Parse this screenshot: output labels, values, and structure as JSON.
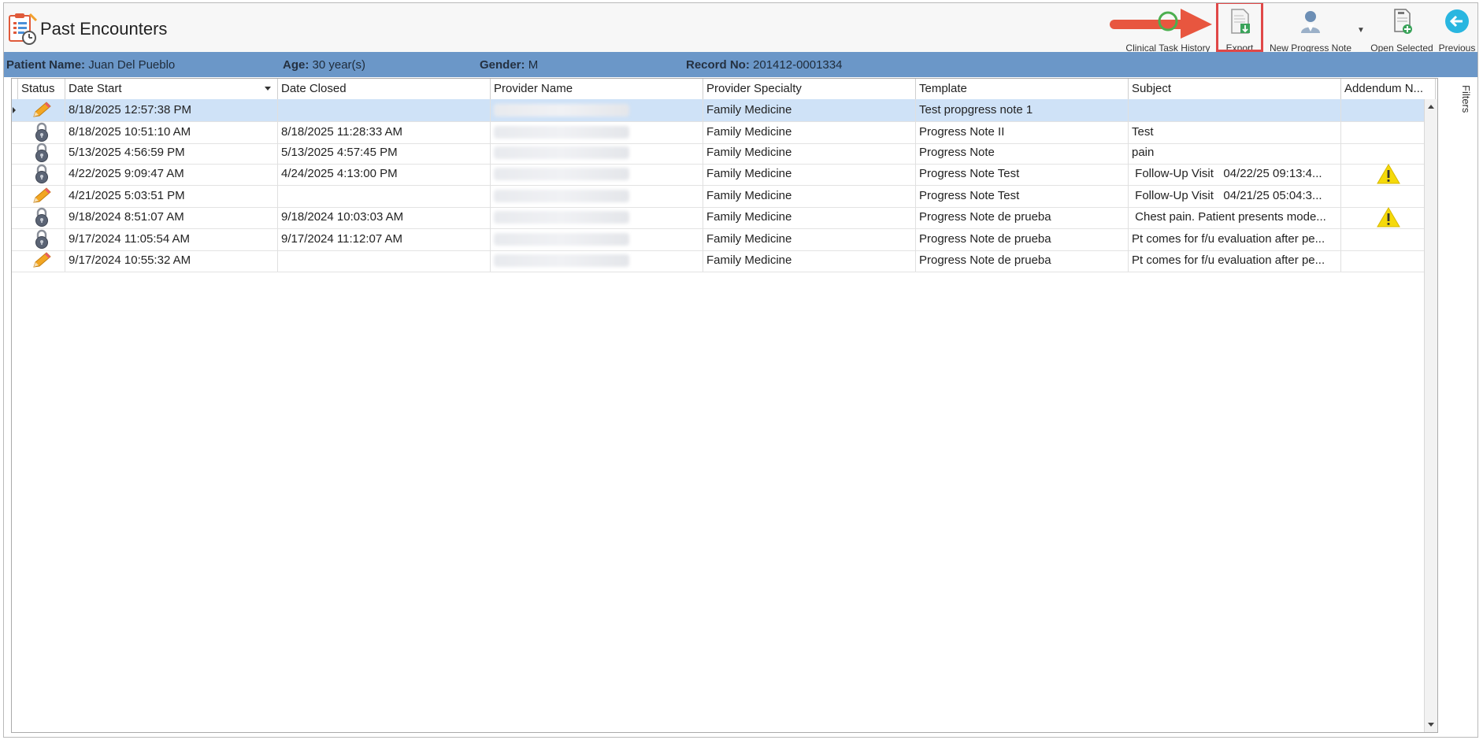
{
  "window": {
    "title": "Past Encounters"
  },
  "toolbar": {
    "clinical_task_history": "Clinical Task History",
    "export": "Export",
    "new_progress_note": "New Progress Note",
    "open_selected": "Open Selected",
    "previous": "Previous"
  },
  "patient": {
    "name_label": "Patient Name:",
    "name": "Juan Del Pueblo",
    "age_label": "Age:",
    "age": "30 year(s)",
    "gender_label": "Gender:",
    "gender": "M",
    "record_label": "Record No:",
    "record": "201412-0001334"
  },
  "grid": {
    "columns": [
      "Status",
      "Date Start",
      "Date Closed",
      "Provider Name",
      "Provider Specialty",
      "Template",
      "Subject",
      "Addendum N..."
    ],
    "rows": [
      {
        "status": "pencil",
        "date_start": "8/18/2025 12:57:38 PM",
        "date_closed": "",
        "specialty": "Family Medicine",
        "template": "Test propgress note 1",
        "subject": "",
        "warning": false
      },
      {
        "status": "lock",
        "date_start": "8/18/2025 10:51:10 AM",
        "date_closed": "8/18/2025 11:28:33 AM",
        "specialty": "Family Medicine",
        "template": "Progress Note II",
        "subject": "Test",
        "warning": false
      },
      {
        "status": "lock",
        "date_start": "5/13/2025 4:56:59 PM",
        "date_closed": "5/13/2025 4:57:45 PM",
        "specialty": "Family Medicine",
        "template": "Progress Note",
        "subject": "pain",
        "warning": false
      },
      {
        "status": "lock",
        "date_start": "4/22/2025 9:09:47 AM",
        "date_closed": "4/24/2025 4:13:00 PM",
        "specialty": "Family Medicine",
        "template": "Progress Note Test",
        "subject": " Follow-Up Visit   04/22/25 09:13:4...",
        "warning": true
      },
      {
        "status": "pencil",
        "date_start": "4/21/2025 5:03:51 PM",
        "date_closed": "",
        "specialty": "Family Medicine",
        "template": "Progress Note Test",
        "subject": " Follow-Up Visit   04/21/25 05:04:3...",
        "warning": false
      },
      {
        "status": "lock",
        "date_start": "9/18/2024 8:51:07 AM",
        "date_closed": "9/18/2024 10:03:03 AM",
        "specialty": "Family Medicine",
        "template": "Progress Note de prueba",
        "subject": " Chest pain. Patient presents mode...",
        "warning": true
      },
      {
        "status": "lock",
        "date_start": "9/17/2024 11:05:54 AM",
        "date_closed": "9/17/2024 11:12:07 AM",
        "specialty": "Family Medicine",
        "template": "Progress Note de prueba",
        "subject": "Pt comes for f/u evaluation after pe...",
        "warning": false
      },
      {
        "status": "pencil",
        "date_start": "9/17/2024 10:55:32 AM",
        "date_closed": "",
        "specialty": "Family Medicine",
        "template": "Progress Note de prueba",
        "subject": "Pt comes for f/u evaluation after pe...",
        "warning": false
      }
    ]
  },
  "side_panel": {
    "filters": "Filters"
  },
  "colors": {
    "patient_bar": "#6b97c8",
    "selected_row": "#cfe2f7",
    "highlight": "#e04848",
    "warning": "#f5d90a"
  }
}
